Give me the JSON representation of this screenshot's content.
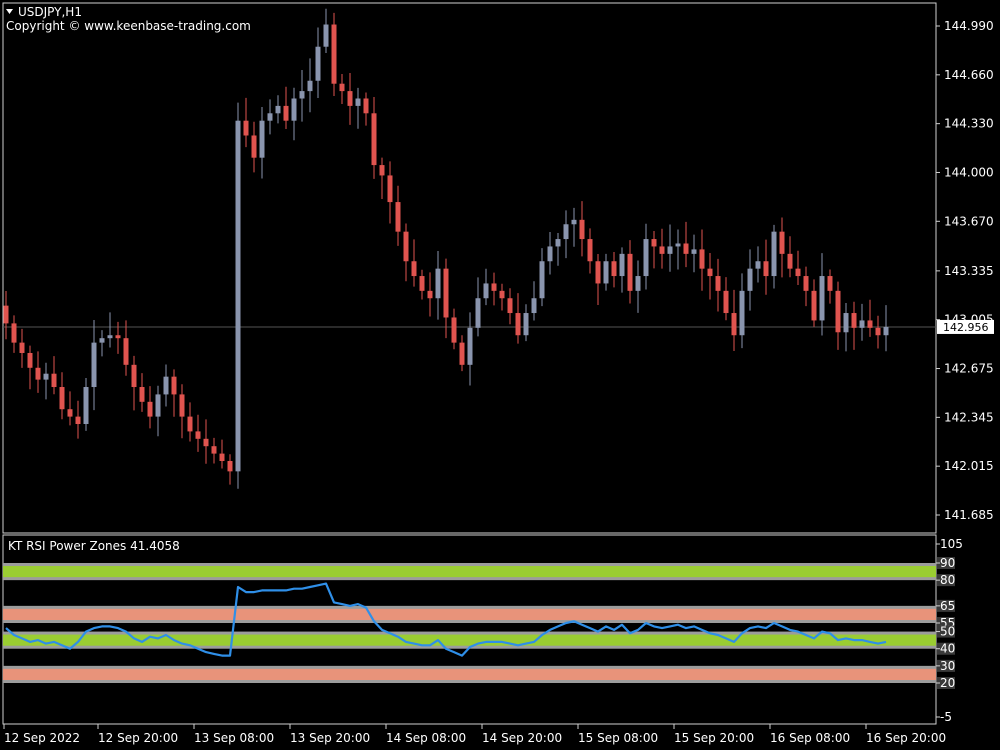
{
  "window": {
    "symbol_label": "USDJPY,H1",
    "copyright": "Copyright © www.keenbase-trading.com",
    "indicator_label": "KT RSI Power Zones 41.4058",
    "current_price": "142.956"
  },
  "colors": {
    "background": "#000000",
    "bull": "#8a95ae",
    "bear": "#e0544f",
    "rsi_line": "#2f8fe8",
    "power_zone": "#9acd32",
    "weak_zone": "#e8937a"
  },
  "chart_data": [
    {
      "type": "candlestick",
      "y_ticks": [
        "144.990",
        "144.660",
        "144.330",
        "144.000",
        "143.670",
        "143.335",
        "143.005",
        "142.675",
        "142.345",
        "142.015",
        "141.685"
      ],
      "ylim": [
        141.6,
        145.1
      ],
      "x_tick_labels": [
        "12 Sep 2022",
        "12 Sep 20:00",
        "13 Sep 08:00",
        "13 Sep 20:00",
        "14 Sep 08:00",
        "14 Sep 20:00",
        "15 Sep 08:00",
        "15 Sep 20:00",
        "16 Sep 08:00",
        "16 Sep 20:00"
      ],
      "current_price": 142.956,
      "close": [
        142.98,
        142.85,
        142.78,
        142.68,
        142.6,
        142.64,
        142.55,
        142.4,
        142.35,
        142.3,
        142.55,
        142.85,
        142.88,
        142.9,
        142.88,
        142.7,
        142.55,
        142.45,
        142.35,
        142.5,
        142.62,
        142.5,
        142.35,
        142.25,
        142.2,
        142.15,
        142.1,
        142.05,
        141.98,
        144.35,
        144.25,
        144.1,
        144.35,
        144.4,
        144.45,
        144.35,
        144.5,
        144.55,
        144.62,
        144.85,
        145.0,
        144.6,
        144.55,
        144.45,
        144.5,
        144.4,
        144.05,
        143.98,
        143.8,
        143.6,
        143.4,
        143.3,
        143.2,
        143.15,
        143.35,
        143.02,
        142.85,
        142.7,
        142.95,
        143.15,
        143.25,
        143.2,
        143.15,
        143.05,
        142.9,
        143.05,
        143.15,
        143.4,
        143.5,
        143.55,
        143.65,
        143.68,
        143.55,
        143.4,
        143.25,
        143.4,
        143.3,
        143.45,
        143.2,
        143.3,
        143.55,
        143.5,
        143.45,
        143.5,
        143.52,
        143.45,
        143.48,
        143.35,
        143.3,
        143.2,
        143.05,
        142.9,
        143.2,
        143.35,
        143.4,
        143.3,
        143.6,
        143.45,
        143.35,
        143.3,
        143.2,
        143.0,
        143.3,
        143.2,
        142.92,
        143.05,
        142.95,
        143.0,
        142.95,
        142.9,
        142.956
      ],
      "rsi": {
        "type": "line",
        "y_ticks": [
          "105",
          "90",
          "80",
          "65",
          "55",
          "50",
          "40",
          "30",
          "20",
          "-5"
        ],
        "ylim": [
          -5,
          105
        ],
        "power_zones": [
          [
            80,
            90
          ],
          [
            40,
            50
          ]
        ],
        "weak_zones": [
          [
            55,
            65
          ],
          [
            20,
            30
          ]
        ],
        "values": [
          52,
          48,
          46,
          44,
          45,
          43,
          44,
          42,
          40,
          44,
          50,
          52,
          53,
          53,
          52,
          50,
          46,
          44,
          47,
          46,
          48,
          45,
          43,
          42,
          40,
          38,
          37,
          36,
          36,
          76,
          73,
          73,
          74,
          74,
          74,
          74,
          75,
          75,
          76,
          77,
          78,
          67,
          66,
          65,
          66,
          64,
          56,
          51,
          49,
          47,
          44,
          43,
          42,
          42,
          45,
          40,
          38,
          36,
          41,
          43,
          44,
          44,
          44,
          43,
          42,
          43,
          44,
          48,
          51,
          53,
          55,
          56,
          54,
          52,
          50,
          53,
          51,
          54,
          49,
          51,
          55,
          53,
          52,
          53,
          54,
          52,
          53,
          51,
          49,
          48,
          46,
          44,
          49,
          52,
          53,
          52,
          55,
          53,
          51,
          50,
          48,
          46,
          50,
          49,
          45,
          46,
          45,
          45,
          44,
          43,
          44
        ]
      }
    }
  ]
}
